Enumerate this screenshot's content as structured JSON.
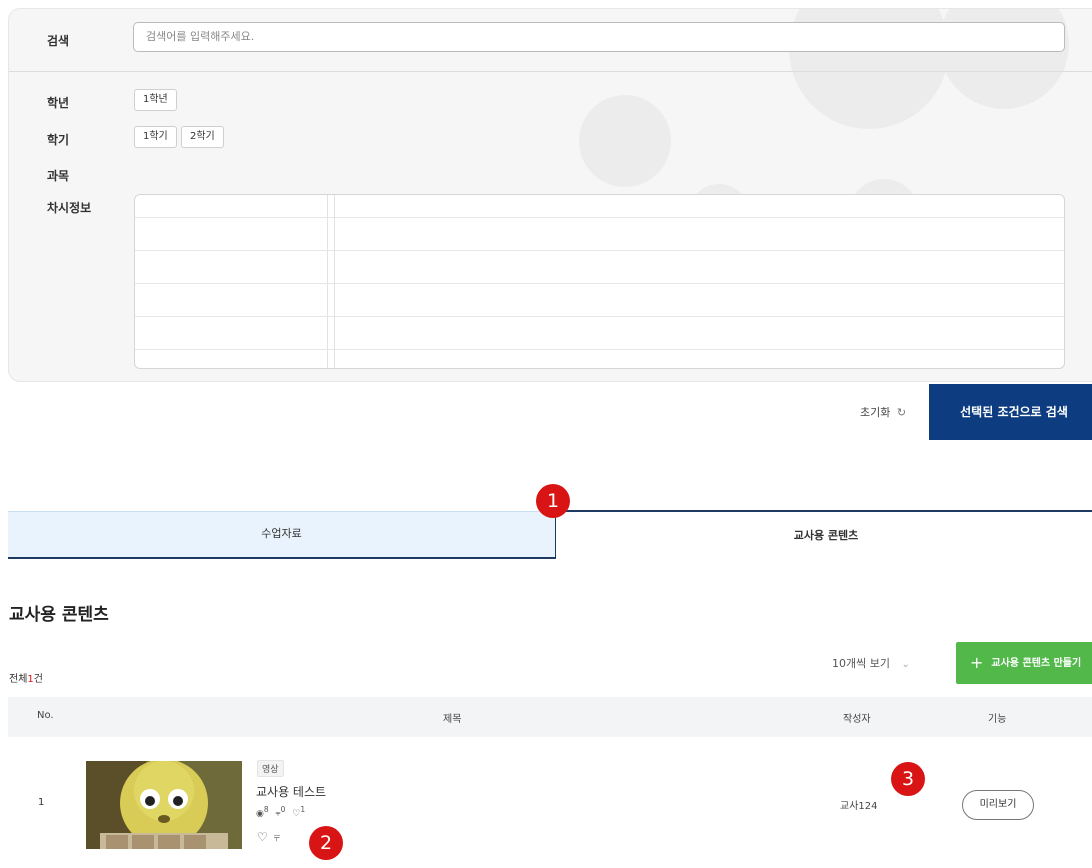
{
  "search": {
    "label": "검색",
    "placeholder": "검색어를 입력해주세요."
  },
  "filters": {
    "grade_label": "학년",
    "grade_options": [
      "1학년"
    ],
    "semester_label": "학기",
    "semester_options": [
      "1학기",
      "2학기"
    ],
    "subject_label": "과목",
    "lesson_label": "차시정보"
  },
  "actions": {
    "reset_label": "초기화",
    "reset_icon": "refresh-icon",
    "search_label": "선택된 조건으로 검색"
  },
  "tabs": [
    {
      "label": "수업자료",
      "active": false
    },
    {
      "label": "교사용 콘텐츠",
      "active": true
    }
  ],
  "markers": [
    "1",
    "2",
    "3"
  ],
  "section": {
    "title": "교사용 콘텐츠",
    "total_prefix": "전체",
    "total_count": "1",
    "total_suffix": "건"
  },
  "toolbar": {
    "per_page": "10개씩 보기",
    "create_label": "교사용 콘텐츠 만들기"
  },
  "table": {
    "columns": [
      "No.",
      "제목",
      "작성자",
      "기능"
    ],
    "rows": [
      {
        "no": "1",
        "badge": "영상",
        "title": "교사용 테스트",
        "views": "8",
        "shares": "0",
        "likes": "1",
        "author": "교사124",
        "action": "미리보기"
      }
    ]
  },
  "colors": {
    "primary": "#0d3d80",
    "green": "#51b849",
    "marker": "#d81414",
    "tab_bg": "#e8f3fd"
  }
}
